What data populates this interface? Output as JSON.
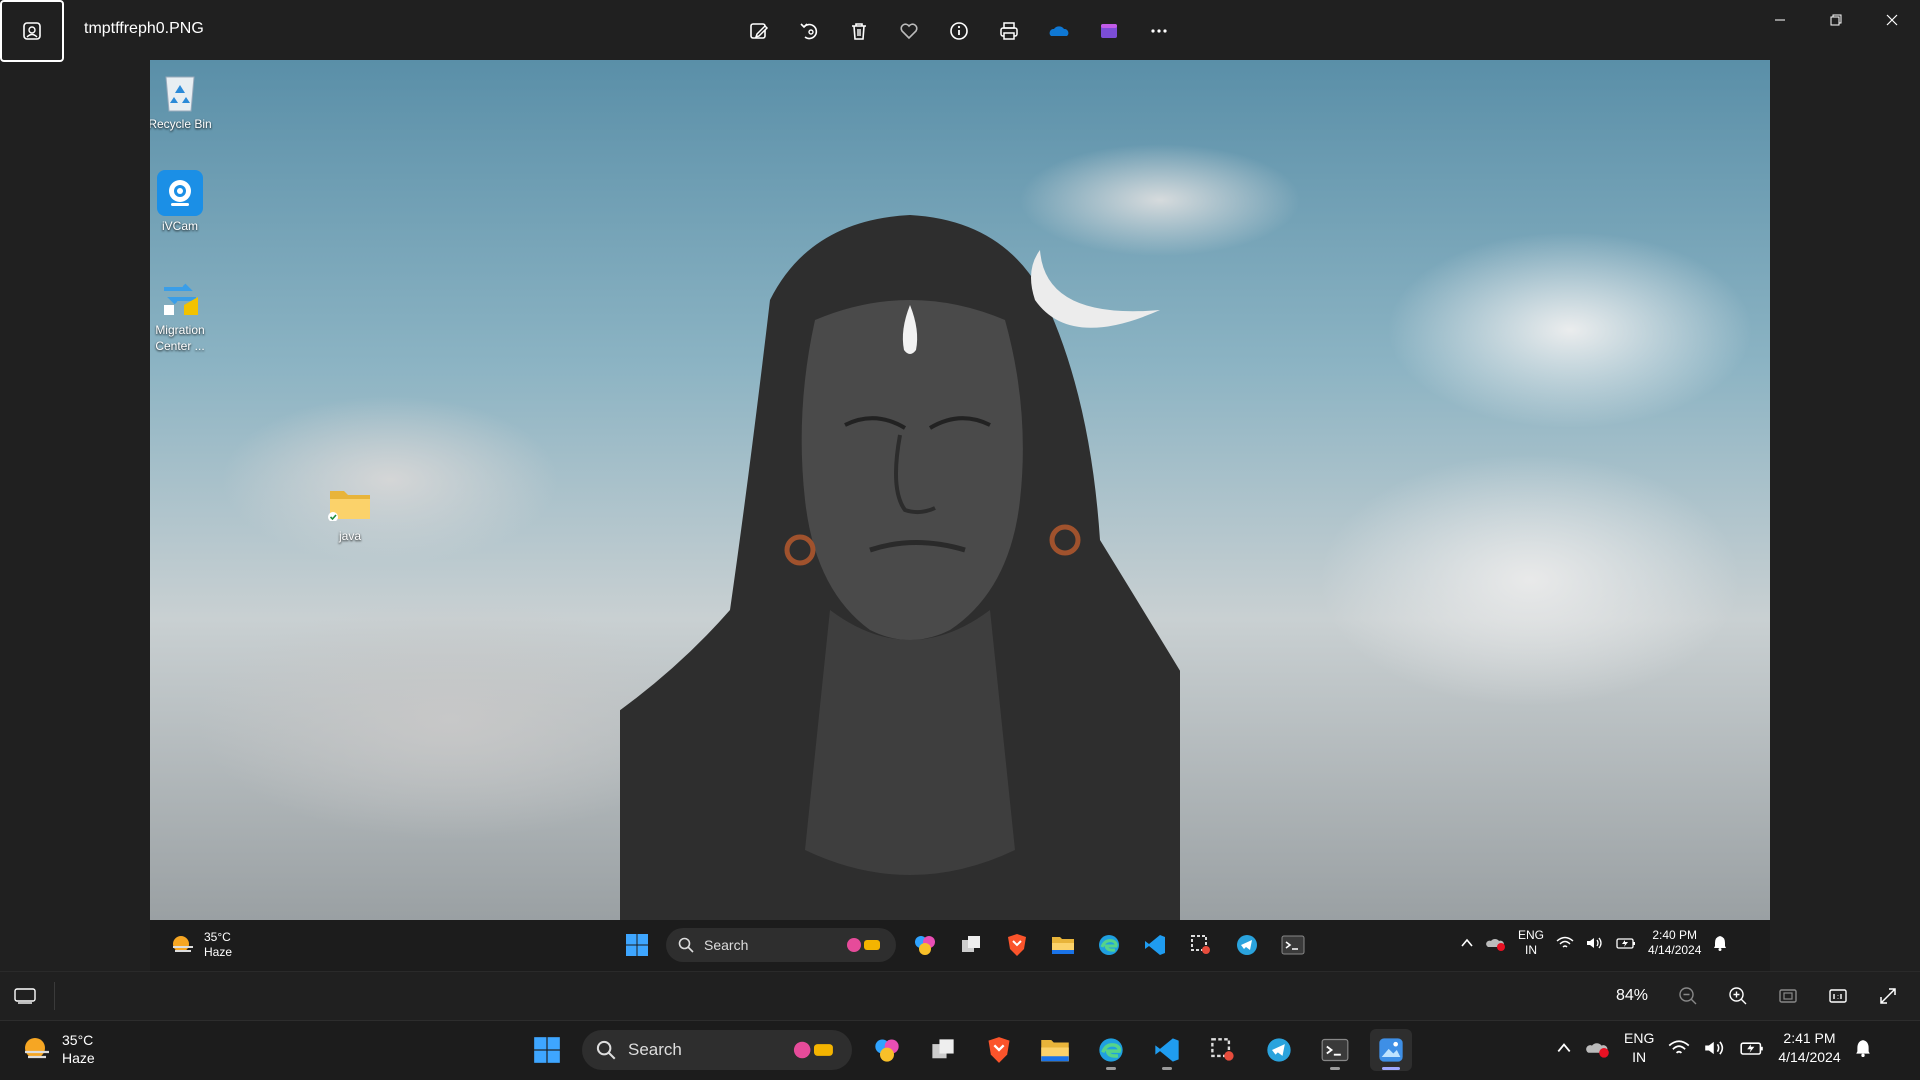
{
  "window": {
    "file_name": "tmptffreph0.PNG"
  },
  "toolbar": {
    "items": [
      "edit-image-icon",
      "rotate-icon",
      "delete-icon",
      "favorite-icon",
      "info-icon",
      "print-icon",
      "onedrive-icon",
      "clipchamp-icon",
      "more-icon"
    ]
  },
  "desktop": {
    "icons": [
      {
        "label": "Recycle Bin"
      },
      {
        "label": "iVCam"
      },
      {
        "label": "Migration Center ..."
      },
      {
        "label": "java"
      }
    ]
  },
  "inner_taskbar": {
    "temperature": "35°C",
    "condition": "Haze",
    "search_placeholder": "Search",
    "lang_top": "ENG",
    "lang_bottom": "IN",
    "time": "2:40 PM",
    "date": "4/14/2024"
  },
  "zoombar": {
    "zoom_level": "84%"
  },
  "taskbar": {
    "temperature": "35°C",
    "condition": "Haze",
    "search_placeholder": "Search",
    "lang_top": "ENG",
    "lang_bottom": "IN",
    "time": "2:41 PM",
    "date": "4/14/2024"
  },
  "colors": {
    "accent": "#0078d4",
    "active_indicator": "#9fa8ff",
    "background": "#202020"
  }
}
